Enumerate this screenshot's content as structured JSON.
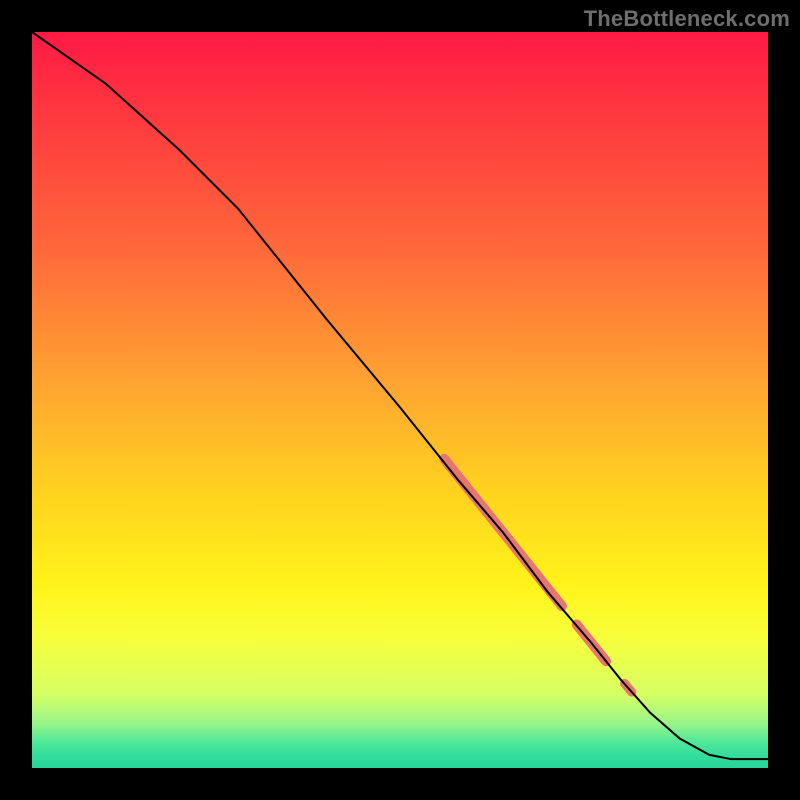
{
  "watermark": "TheBottleneck.com",
  "colors": {
    "gradient_stops": [
      {
        "offset": 0.0,
        "color": "#ff1a44"
      },
      {
        "offset": 0.12,
        "color": "#ff3a3f"
      },
      {
        "offset": 0.3,
        "color": "#ff6a3a"
      },
      {
        "offset": 0.48,
        "color": "#ffa531"
      },
      {
        "offset": 0.62,
        "color": "#ffd11f"
      },
      {
        "offset": 0.75,
        "color": "#fff31a"
      },
      {
        "offset": 0.82,
        "color": "#f8ff3a"
      },
      {
        "offset": 0.9,
        "color": "#d5ff66"
      },
      {
        "offset": 0.94,
        "color": "#96f58a"
      },
      {
        "offset": 0.965,
        "color": "#4ee89a"
      },
      {
        "offset": 0.985,
        "color": "#2fdc9c"
      },
      {
        "offset": 1.0,
        "color": "#29d49a"
      }
    ],
    "line": "#000000",
    "marker": "#e97570",
    "frame": "#000000"
  },
  "chart_data": {
    "type": "line",
    "title": "",
    "xlabel": "",
    "ylabel": "",
    "xlim": [
      0,
      100
    ],
    "ylim": [
      0,
      100
    ],
    "series": [
      {
        "name": "curve",
        "x": [
          0,
          10,
          20,
          28,
          40,
          50,
          58,
          64,
          70,
          76,
          80,
          84,
          88,
          92,
          95,
          100
        ],
        "y": [
          100,
          93,
          84,
          76,
          61,
          49,
          39,
          32,
          24,
          17,
          12,
          7.5,
          4.0,
          1.8,
          1.2,
          1.2
        ]
      }
    ],
    "highlight_segments": [
      {
        "x0": 56,
        "y0": 42,
        "x1": 72,
        "y1": 22,
        "width": 10
      },
      {
        "x0": 74,
        "y0": 19.5,
        "x1": 78,
        "y1": 14.5,
        "width": 10
      },
      {
        "x0": 80.5,
        "y0": 11.5,
        "x1": 81.5,
        "y1": 10.3,
        "width": 9
      }
    ]
  }
}
